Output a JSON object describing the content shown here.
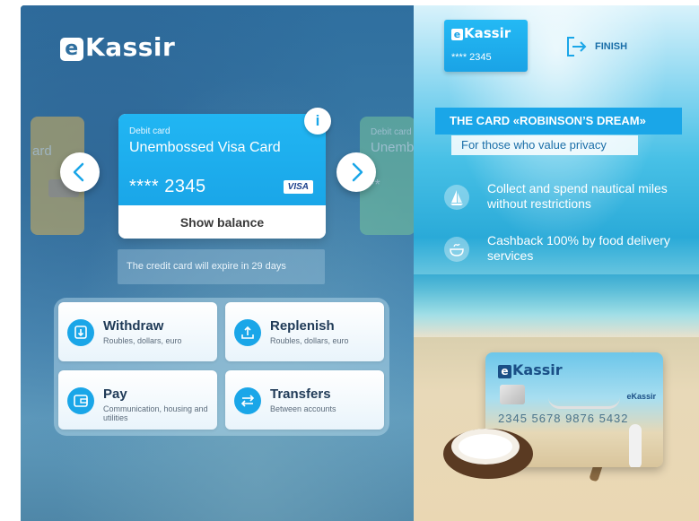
{
  "brand": {
    "logo_text": "Kassir",
    "logo_mark": "e"
  },
  "card": {
    "type": "Debit card",
    "name": "Unembossed Visa Card",
    "masked_number": "**** 2345",
    "network": "VISA",
    "show_balance": "Show balance",
    "info": "i"
  },
  "neighbor_cards": {
    "left_label": "ard",
    "right_type": "Debit card",
    "right_name": "Unemb",
    "right_number": "***"
  },
  "expire_notice": "The credit card will expire in 29 days",
  "actions": [
    {
      "title": "Withdraw",
      "subtitle": "Roubles, dollars, euro",
      "icon": "withdraw-icon"
    },
    {
      "title": "Replenish",
      "subtitle": "Roubles, dollars, euro",
      "icon": "replenish-icon"
    },
    {
      "title": "Pay",
      "subtitle": "Communication, housing and utilities",
      "icon": "wallet-icon"
    },
    {
      "title": "Transfers",
      "subtitle": "Between accounts",
      "icon": "transfer-icon"
    }
  ],
  "right_panel": {
    "mini_card": {
      "logo_text": "Kassir",
      "logo_mark": "e",
      "number": "**** 2345"
    },
    "finish_label": "FINISH",
    "promo_title": "THE CARD «ROBINSON’S DREAM»",
    "promo_subtitle": "For those who value privacy",
    "features": [
      {
        "text": "Collect and spend nautical miles without restrictions",
        "icon": "sailboat-icon"
      },
      {
        "text": "Cashback 100% by food delivery services",
        "icon": "food-bowl-icon"
      }
    ],
    "promo_card": {
      "logo_text": "Kassir",
      "logo_mark": "e",
      "number": "2345 5678 9876 5432",
      "brand_small": "eKassir"
    }
  },
  "colors": {
    "accent": "#1aa6e8",
    "panel_blue": "#2f6f9f",
    "dark_text": "#1f3a57"
  }
}
